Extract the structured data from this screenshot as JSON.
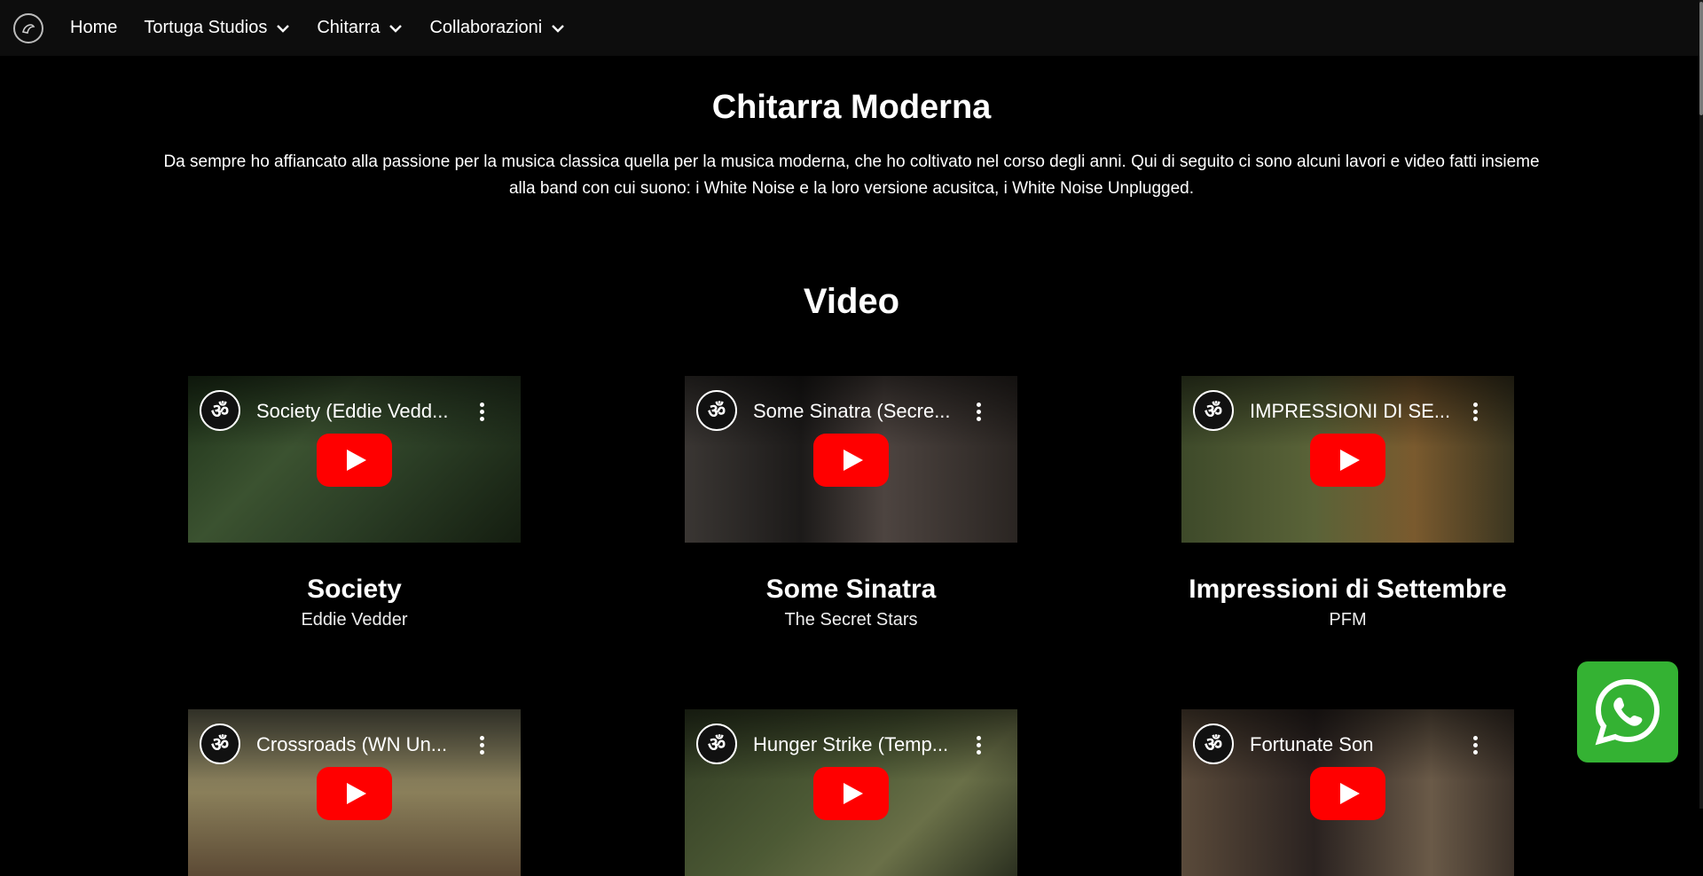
{
  "nav": {
    "items": [
      {
        "label": "Home",
        "dropdown": false
      },
      {
        "label": "Tortuga Studios",
        "dropdown": true
      },
      {
        "label": "Chitarra",
        "dropdown": true
      },
      {
        "label": "Collaborazioni",
        "dropdown": true
      }
    ]
  },
  "page": {
    "title": "Chitarra Moderna",
    "intro": "Da sempre ho affiancato alla passione per la musica classica quella per la musica moderna, che ho coltivato nel corso degli anni. Qui di seguito ci sono alcuni lavori e video fatti insieme alla band con cui suono: i White Noise e la loro versione acusitca, i White Noise Unplugged.",
    "section_title": "Video"
  },
  "videos": [
    {
      "video_title": "Society (Eddie Vedd...",
      "title": "Society",
      "artist": "Eddie Vedder"
    },
    {
      "video_title": "Some Sinatra (Secre...",
      "title": "Some Sinatra",
      "artist": "The Secret Stars"
    },
    {
      "video_title": "IMPRESSIONI DI SE...",
      "title": "Impressioni di Settembre",
      "artist": "PFM"
    },
    {
      "video_title": "Crossroads (WN Un...",
      "title": "",
      "artist": ""
    },
    {
      "video_title": "Hunger Strike (Temp...",
      "title": "",
      "artist": ""
    },
    {
      "video_title": "Fortunate Son",
      "title": "",
      "artist": ""
    }
  ],
  "colors": {
    "background": "#000000",
    "navbar": "#0d0d0d",
    "youtube_red": "#ff0000",
    "whatsapp_green": "#34b233"
  },
  "icons": {
    "logo": "site-logo-icon",
    "dropdown": "chevron-down-icon",
    "play": "play-icon",
    "menu": "more-vertical-icon",
    "whatsapp": "whatsapp-icon"
  }
}
